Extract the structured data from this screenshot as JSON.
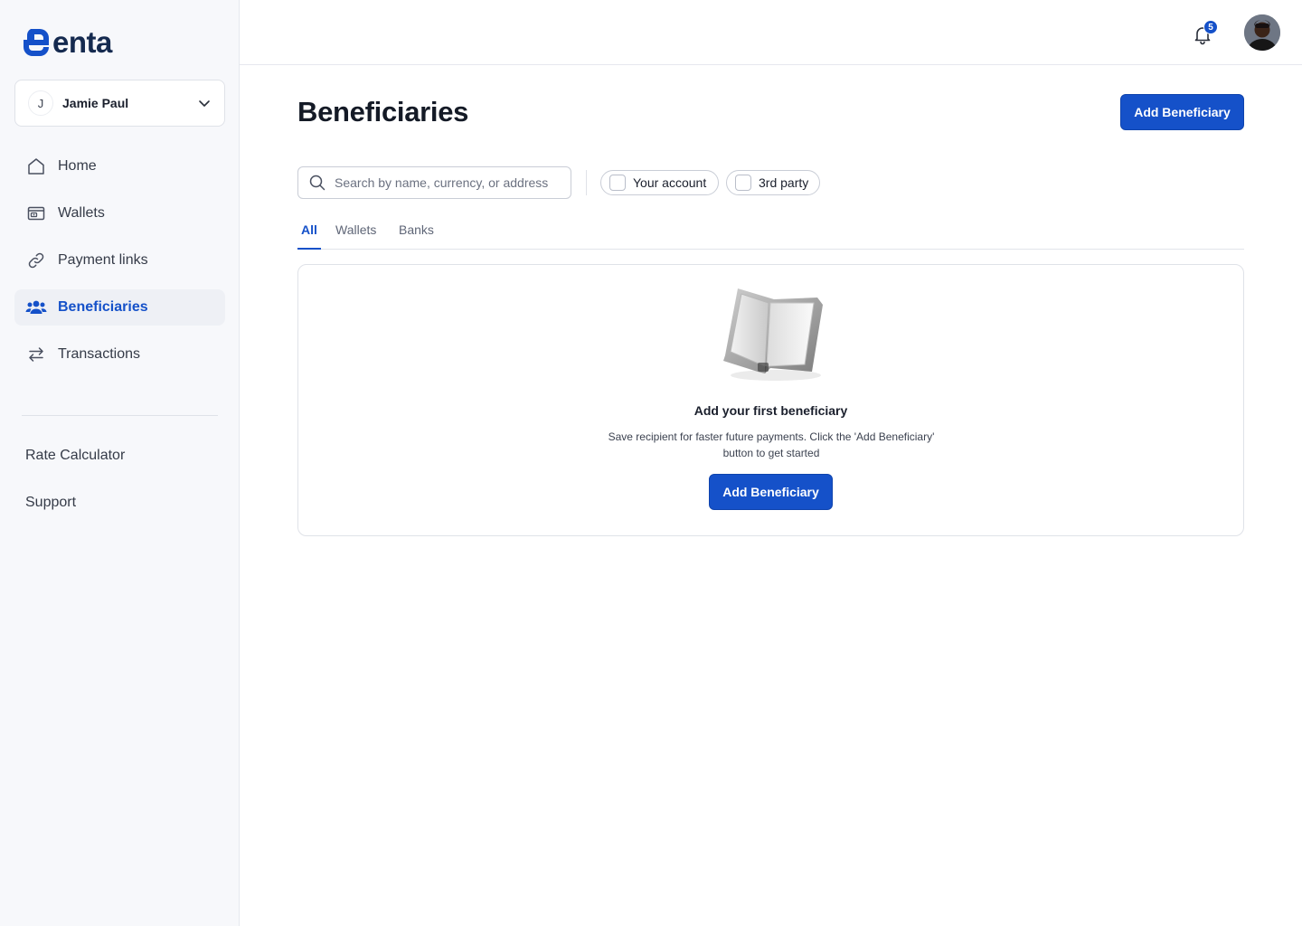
{
  "app": {
    "brand": "enta",
    "accent_color": "#1551c9"
  },
  "account": {
    "initial": "J",
    "name": "Jamie Paul"
  },
  "sidebar": {
    "items": [
      {
        "label": "Home",
        "icon": "home-icon"
      },
      {
        "label": "Wallets",
        "icon": "wallet-icon"
      },
      {
        "label": "Payment links",
        "icon": "link-icon"
      },
      {
        "label": "Beneficiaries",
        "icon": "users-icon",
        "active": true
      },
      {
        "label": "Transactions",
        "icon": "transfer-arrows-icon"
      }
    ],
    "secondary": [
      {
        "label": "Rate Calculator"
      },
      {
        "label": "Support"
      }
    ]
  },
  "header": {
    "notification_count": "5"
  },
  "page": {
    "title": "Beneficiaries",
    "add_button": "Add Beneficiary"
  },
  "search": {
    "placeholder": "Search by name, currency, or address",
    "value": ""
  },
  "filters": [
    {
      "label": "Your account",
      "checked": false
    },
    {
      "label": "3rd party",
      "checked": false
    }
  ],
  "tabs": [
    {
      "label": "All",
      "active": true
    },
    {
      "label": "Wallets",
      "active": false
    },
    {
      "label": "Banks",
      "active": false
    }
  ],
  "empty_state": {
    "title": "Add your first beneficiary",
    "description": "Save recipient for faster future payments. Click the 'Add Beneficiary' button to get started",
    "button": "Add Beneficiary",
    "illustration": "open-book-icon"
  }
}
